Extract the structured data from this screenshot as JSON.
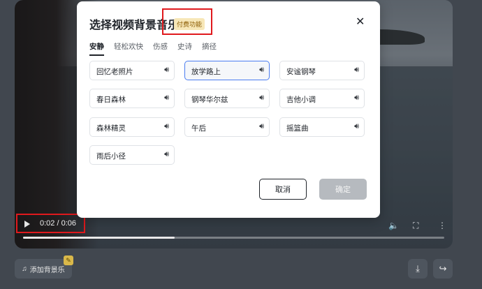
{
  "modal": {
    "title": "选择视频背景音乐",
    "paid_badge": "付费功能",
    "tabs": [
      {
        "label": "安静",
        "active": true
      },
      {
        "label": "轻松欢快",
        "active": false
      },
      {
        "label": "伤感",
        "active": false
      },
      {
        "label": "史诗",
        "active": false
      },
      {
        "label": "摘径",
        "active": false
      }
    ],
    "music_items": [
      {
        "label": "回忆老照片",
        "selected": false
      },
      {
        "label": "放学路上",
        "selected": true
      },
      {
        "label": "安谧钢琴",
        "selected": false
      },
      {
        "label": "春日森林",
        "selected": false
      },
      {
        "label": "钢琴华尔兹",
        "selected": false
      },
      {
        "label": "吉他小调",
        "selected": false
      },
      {
        "label": "森林精灵",
        "selected": false
      },
      {
        "label": "午后",
        "selected": false
      },
      {
        "label": "摇篮曲",
        "selected": false
      },
      {
        "label": "雨后小径",
        "selected": false
      }
    ],
    "cancel_label": "取消",
    "confirm_label": "确定"
  },
  "player": {
    "time": "0:02 / 0:06",
    "progress_fraction": 0.36
  },
  "bottom_bar": {
    "add_music_label": "添加背景乐"
  },
  "icons": {
    "play": "play-icon",
    "volume": "volume-icon",
    "fullscreen": "fullscreen-icon",
    "more": "more-vertical-icon",
    "close": "close-icon",
    "sound": "speaker-icon",
    "music_note": "music-note-icon",
    "download": "download-icon",
    "share": "share-icon",
    "magic_wand": "magic-wand-icon"
  },
  "colors": {
    "selected_border": "#4a7cf0",
    "paid_badge_bg": "#f7e7b8",
    "annotation_red": "#e0191d",
    "confirm_disabled": "#b6babf"
  }
}
